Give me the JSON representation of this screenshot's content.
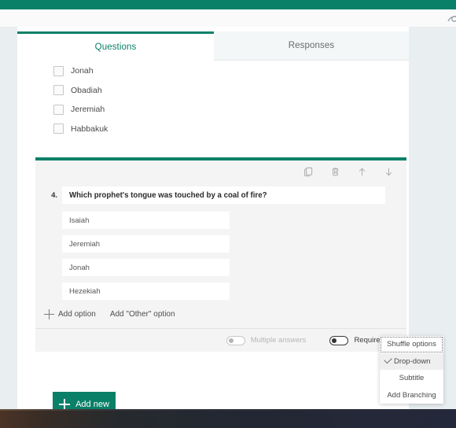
{
  "app": {
    "accent_color": "#0b8068",
    "surface_color": "#ffffff",
    "page_background": "#e9eff1"
  },
  "toolbar": {
    "preview_icon": "preview-gear-icon"
  },
  "tabs": [
    {
      "label": "Questions",
      "active": true
    },
    {
      "label": "Responses",
      "active": false
    }
  ],
  "previous_question": {
    "choices": [
      {
        "label": "Jonah",
        "checked": false
      },
      {
        "label": "Obadiah",
        "checked": false
      },
      {
        "label": "Jeremiah",
        "checked": false
      },
      {
        "label": "Habbakuk",
        "checked": false
      }
    ]
  },
  "question_card": {
    "number": "4.",
    "text": "Which prophet's tongue was touched by a coal of fire?",
    "toolbar_icons": [
      "copy-icon",
      "delete-icon",
      "move-up-icon",
      "move-down-icon"
    ],
    "options": [
      {
        "value": "Isaiah"
      },
      {
        "value": "Jeremiah"
      },
      {
        "value": "Jonah"
      },
      {
        "value": "Hezekiah"
      }
    ],
    "add_option_label": "Add option",
    "add_other_option_label": "Add \"Other\" option",
    "settings": {
      "multiple_answers": {
        "label": "Multiple answers",
        "on": false,
        "enabled": false
      },
      "required": {
        "label": "Required",
        "on": false,
        "enabled": true
      }
    }
  },
  "add_new": {
    "label": "Add new"
  },
  "context_menu": {
    "items": [
      {
        "label": "Shuffle options",
        "checked": false,
        "focused": true,
        "hovered": false
      },
      {
        "label": "Drop-down",
        "checked": true,
        "focused": false,
        "hovered": true
      },
      {
        "label": "Subtitle",
        "checked": false,
        "focused": false,
        "hovered": false
      },
      {
        "label": "Add Branching",
        "checked": false,
        "focused": false,
        "hovered": false
      }
    ]
  }
}
